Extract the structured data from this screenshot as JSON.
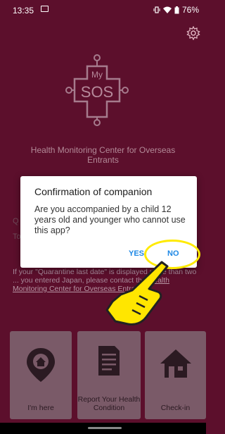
{
  "status_bar": {
    "time": "13:35",
    "battery": "76%"
  },
  "app": {
    "logo_text_top": "My",
    "logo_text_main": "SOS",
    "center_name": "Health Monitoring Center for Overseas Entrants",
    "bg_line_1": "Q",
    "bg_line_2": "To",
    "notice_line_1": "If your \"Quarantine last date\" is displayed more than two ... you entered",
    "notice_line_2": "Japan, please contact the ",
    "notice_link": "Health Monitoring Center for Overseas Entrants"
  },
  "tiles": [
    {
      "label": "I'm here",
      "icon": "location-pin-icon"
    },
    {
      "label": "Report Your Health Condition",
      "icon": "document-icon"
    },
    {
      "label": "Check-in",
      "icon": "house-icon"
    }
  ],
  "dialog": {
    "title": "Confirmation of companion",
    "message": "Are you accompanied by a child 12 years old and younger who cannot use this app?",
    "yes_label": "YES",
    "no_label": "NO"
  },
  "colors": {
    "background": "#5c0f2c",
    "dialog_button": "#1e88e5",
    "highlight": "#ffea00"
  }
}
